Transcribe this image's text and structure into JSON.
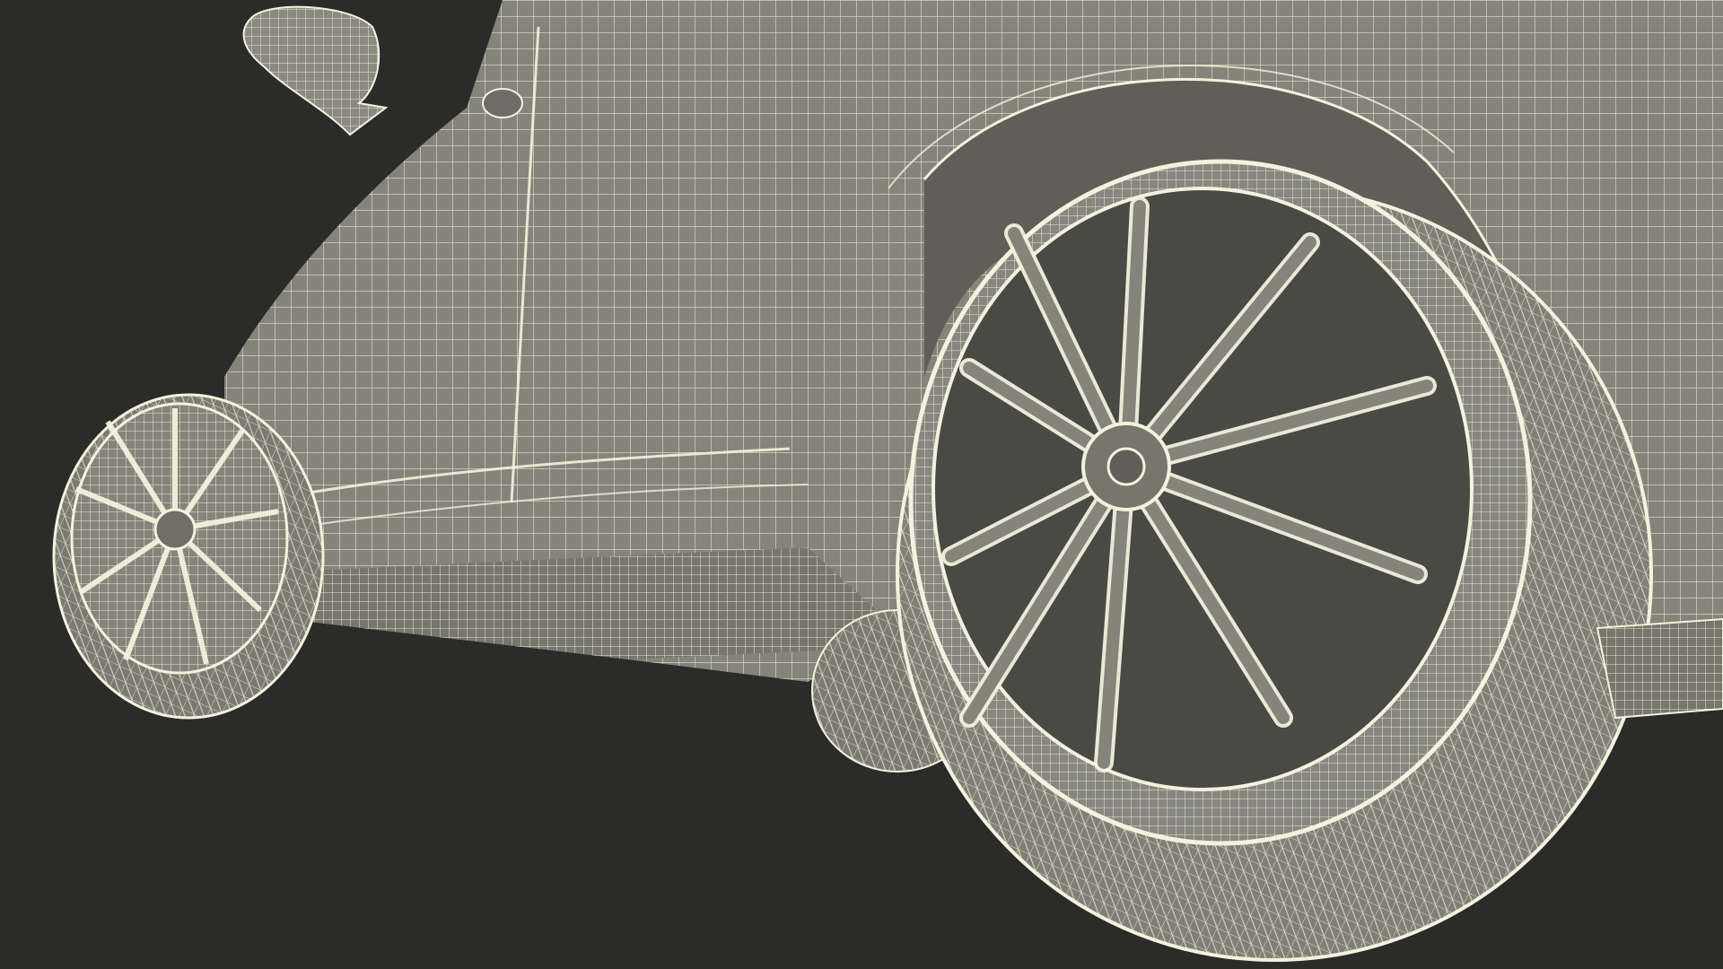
{
  "scene": {
    "background_color": "#2b2b29",
    "body_color": "#84847a",
    "body_dark_color": "#5f5f57",
    "shadow_color": "#3a3a36",
    "wire_color": "#f3f2df",
    "subject_icon": "car-wireframe-render"
  }
}
